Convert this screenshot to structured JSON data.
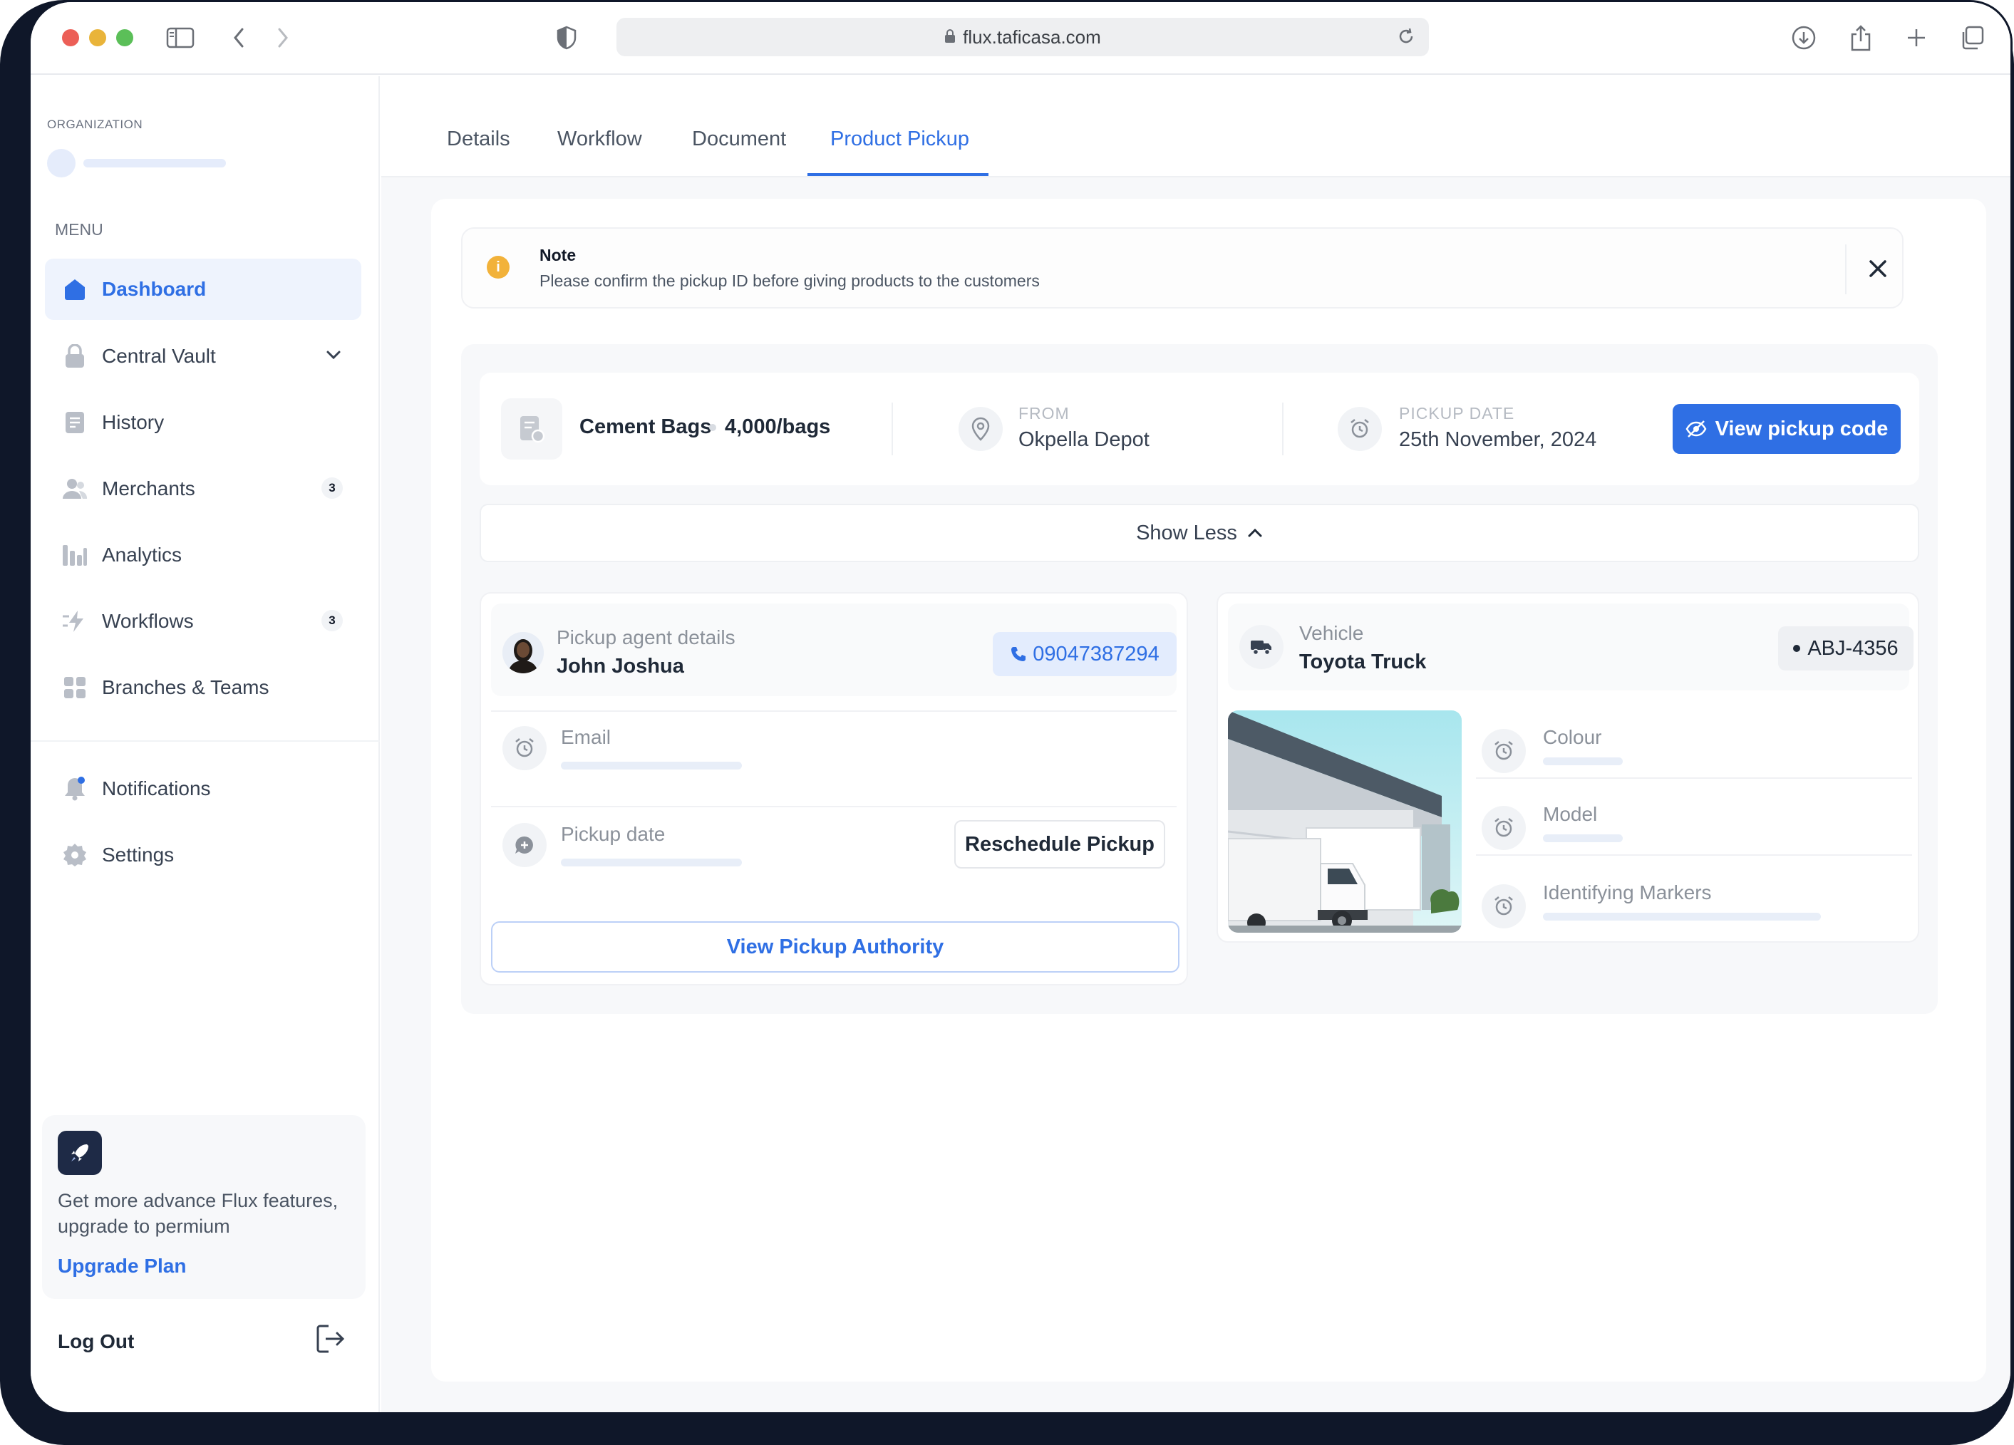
{
  "browser": {
    "url": "flux.taficasa.com"
  },
  "sidebar": {
    "org_label": "ORGANIZATION",
    "menu_label": "MENU",
    "items": [
      {
        "label": "Dashboard",
        "icon": "home-icon",
        "active": true
      },
      {
        "label": "Central Vault",
        "icon": "lock-icon"
      },
      {
        "label": "History",
        "icon": "document-icon"
      },
      {
        "label": "Merchants",
        "icon": "users-icon",
        "badge": "3"
      },
      {
        "label": "Analytics",
        "icon": "bar-chart-icon"
      },
      {
        "label": "Workflows",
        "icon": "lightning-icon",
        "badge": "3"
      },
      {
        "label": "Branches & Teams",
        "icon": "grid-icon"
      }
    ],
    "secondary_items": [
      {
        "label": "Notifications",
        "icon": "bell-icon"
      },
      {
        "label": "Settings",
        "icon": "gear-icon"
      }
    ],
    "upgrade": {
      "text": "Get more advance Flux features, upgrade to permium",
      "link": "Upgrade Plan"
    },
    "logout": "Log Out"
  },
  "tabs": [
    {
      "label": "Details"
    },
    {
      "label": "Workflow"
    },
    {
      "label": "Document"
    },
    {
      "label": "Product Pickup",
      "active": true
    }
  ],
  "note": {
    "title": "Note",
    "body": "Please confirm the pickup ID before giving products to the customers"
  },
  "summary": {
    "product": "Cement Bags",
    "quantity": "4,000/bags",
    "from_label": "FROM",
    "from_value": "Okpella Depot",
    "date_label": "PICKUP DATE",
    "date_value": "25th November, 2024",
    "view_code_button": "View pickup code"
  },
  "show_less": "Show Less",
  "agent": {
    "label": "Pickup agent details",
    "name": "John Joshua",
    "phone": "09047387294",
    "email_label": "Email",
    "pickup_date_label": "Pickup date",
    "reschedule_button": "Reschedule Pickup",
    "authority_button": "View Pickup Authority"
  },
  "vehicle": {
    "label": "Vehicle",
    "name": "Toyota Truck",
    "plate": "ABJ-4356",
    "colour_label": "Colour",
    "model_label": "Model",
    "markers_label": "Identifying Markers"
  },
  "colors": {
    "accent": "#2f6fe4",
    "frame": "#0f1729",
    "note_icon": "#f2b23a"
  }
}
